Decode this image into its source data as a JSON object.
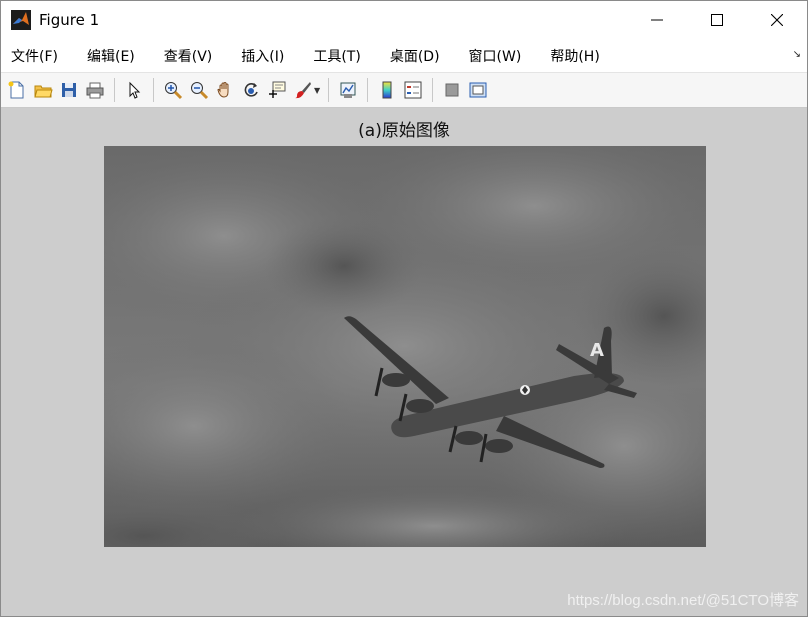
{
  "window": {
    "title": "Figure 1"
  },
  "menu": {
    "items": [
      "文件(F)",
      "编辑(E)",
      "查看(V)",
      "插入(I)",
      "工具(T)",
      "桌面(D)",
      "窗口(W)",
      "帮助(H)"
    ],
    "overflow_icon": "double-chevron-icon"
  },
  "toolbar": {
    "buttons": [
      "new-figure-icon",
      "open-file-icon",
      "save-icon",
      "print-icon",
      "edit-plot-icon",
      "zoom-in-icon",
      "zoom-out-icon",
      "pan-icon",
      "rotate-3d-icon",
      "data-cursor-icon",
      "brush-icon",
      "link-plot-icon",
      "colorbar-icon",
      "legend-icon",
      "hide-plot-tools-icon",
      "show-plot-tools-icon"
    ]
  },
  "figure": {
    "axes_title": "(a)原始图像",
    "image_description": "grayscale photo of a four-engine propeller bomber flying through clouds"
  },
  "watermark": "https://blog.csdn.net/@51CTO博客",
  "colors": {
    "canvas_bg": "#cdcdcd",
    "toolbar_bg": "#f6f6f6"
  }
}
